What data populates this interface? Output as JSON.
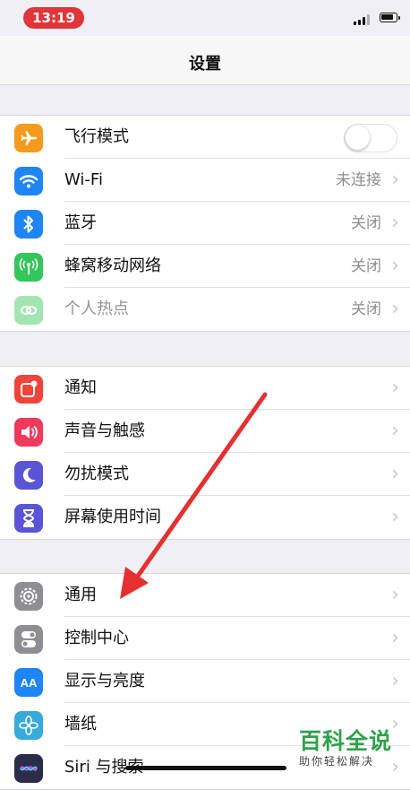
{
  "status_bar": {
    "time": "13:19"
  },
  "nav": {
    "title": "设置"
  },
  "groups": [
    {
      "rows": [
        {
          "id": "airplane",
          "label": "飞行模式",
          "icon": "airplane-icon",
          "color": "#f39a1f",
          "control": "toggle",
          "toggle_on": false
        },
        {
          "id": "wifi",
          "label": "Wi-Fi",
          "value": "未连接",
          "icon": "wifi-icon",
          "color": "#1f85f4"
        },
        {
          "id": "bluetooth",
          "label": "蓝牙",
          "value": "关闭",
          "icon": "bluetooth-icon",
          "color": "#1f85f4"
        },
        {
          "id": "cellular",
          "label": "蜂窝移动网络",
          "value": "关闭",
          "icon": "cellular-antenna-icon",
          "color": "#33c659"
        },
        {
          "id": "hotspot",
          "label": "个人热点",
          "value": "关闭",
          "icon": "hotspot-link-icon",
          "color": "#33c659",
          "disabled": true
        }
      ]
    },
    {
      "rows": [
        {
          "id": "notifications",
          "label": "通知",
          "icon": "notifications-icon",
          "color": "#f0433a"
        },
        {
          "id": "sounds",
          "label": "声音与触感",
          "icon": "speaker-icon",
          "color": "#ef3a5e"
        },
        {
          "id": "dnd",
          "label": "勿扰模式",
          "icon": "moon-icon",
          "color": "#5a54d6"
        },
        {
          "id": "screentime",
          "label": "屏幕使用时间",
          "icon": "hourglass-icon",
          "color": "#5a54d6"
        }
      ]
    },
    {
      "rows": [
        {
          "id": "general",
          "label": "通用",
          "icon": "gear-icon",
          "color": "#8e8e93"
        },
        {
          "id": "control_center",
          "label": "控制中心",
          "icon": "switches-icon",
          "color": "#8e8e93"
        },
        {
          "id": "display",
          "label": "显示与亮度",
          "icon": "text-size-icon",
          "color": "#1f85f4",
          "icon_text": "AA"
        },
        {
          "id": "wallpaper",
          "label": "墙纸",
          "icon": "flower-icon",
          "color": "#36aadc"
        },
        {
          "id": "siri",
          "label": "Siri 与搜索",
          "icon": "siri-icon",
          "color": "#2b2b4a"
        }
      ]
    }
  ],
  "watermark": {
    "title": "百科全说",
    "subtitle": "助你轻松解决"
  },
  "colors": {
    "annotation_arrow": "#e53030"
  }
}
